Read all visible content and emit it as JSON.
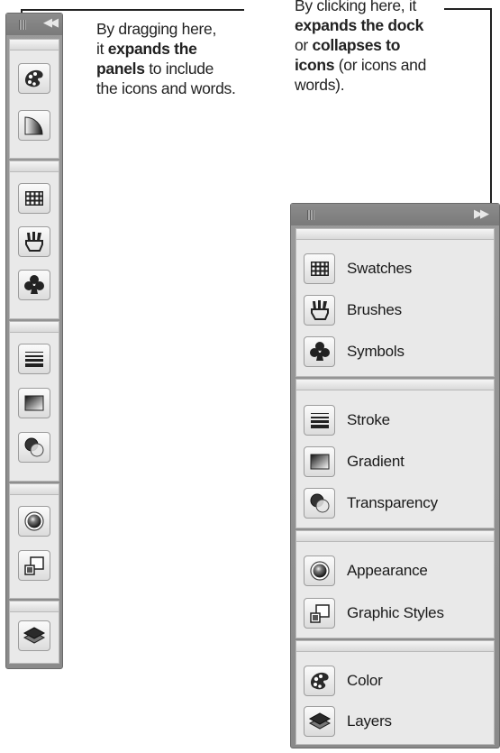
{
  "callouts": {
    "drag": {
      "line1": "By dragging here,",
      "line2_pre": "it ",
      "line2_bold": "expands the",
      "line3_bold": "panels",
      "line3_post": " to include",
      "line4": "the icons and words."
    },
    "click": {
      "line1": "By clicking here, it",
      "line2_bold": "expands the dock",
      "line3_pre": "or ",
      "line3_bold": "collapses to",
      "line4_bold": "icons",
      "line4_post": " (or icons and",
      "line5": "words)."
    }
  },
  "dock_collapsed": {
    "header": {
      "grip_icon": "grip-icon",
      "toggle_glyph": "◀◀"
    },
    "groups": [
      {
        "icons": [
          "color-icon",
          "color-guide-icon"
        ]
      },
      {
        "icons": [
          "swatches-icon",
          "brushes-icon",
          "symbols-icon"
        ]
      },
      {
        "icons": [
          "stroke-icon",
          "gradient-icon",
          "transparency-icon"
        ]
      },
      {
        "icons": [
          "appearance-icon",
          "graphic-styles-icon"
        ]
      },
      {
        "icons": [
          "layers-icon"
        ]
      }
    ]
  },
  "dock_expanded": {
    "header": {
      "grip_icon": "grip-icon",
      "toggle_glyph": "▶▶"
    },
    "groups": [
      {
        "items": [
          {
            "label": "Swatches",
            "icon": "swatches-icon"
          },
          {
            "label": "Brushes",
            "icon": "brushes-icon"
          },
          {
            "label": "Symbols",
            "icon": "symbols-icon"
          }
        ]
      },
      {
        "items": [
          {
            "label": "Stroke",
            "icon": "stroke-icon"
          },
          {
            "label": "Gradient",
            "icon": "gradient-icon"
          },
          {
            "label": "Transparency",
            "icon": "transparency-icon"
          }
        ]
      },
      {
        "items": [
          {
            "label": "Appearance",
            "icon": "appearance-icon"
          },
          {
            "label": "Graphic Styles",
            "icon": "graphic-styles-icon"
          }
        ]
      },
      {
        "items": [
          {
            "label": "Color",
            "icon": "color-icon"
          },
          {
            "label": "Layers",
            "icon": "layers-icon"
          }
        ]
      }
    ]
  }
}
